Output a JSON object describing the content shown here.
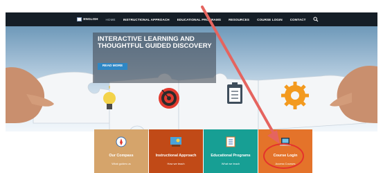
{
  "nav": {
    "language": "ENGLISH",
    "items": [
      "HOME",
      "INSTRUCTIONAL APPROACH",
      "EDUCATIONAL PROGRAMS",
      "RESOURCES",
      "COURSE LOGIN",
      "CONTACT"
    ],
    "active": "HOME"
  },
  "hero": {
    "headline": "INTERACTIVE LEARNING AND THOUGHTFUL GUIDED DISCOVERY",
    "button": "READ MORE",
    "puzzle_icons": [
      "lightbulb-icon",
      "target-icon",
      "clipboard-icon",
      "gear-icon"
    ]
  },
  "tiles": [
    {
      "title": "Our Compass",
      "subtitle": "What guides us",
      "color": "#d5a46b",
      "icon": "compass-icon"
    },
    {
      "title": "Instructional Approach",
      "subtitle": "How we teach",
      "color": "#c14a17",
      "icon": "presentation-icon"
    },
    {
      "title": "Educational Programs",
      "subtitle": "What we teach",
      "color": "#179f94",
      "icon": "book-icon"
    },
    {
      "title": "Course Login",
      "subtitle": "Access Courses",
      "color": "#e4732a",
      "icon": "laptop-icon"
    }
  ],
  "annotation": {
    "color": "#e4322c"
  }
}
